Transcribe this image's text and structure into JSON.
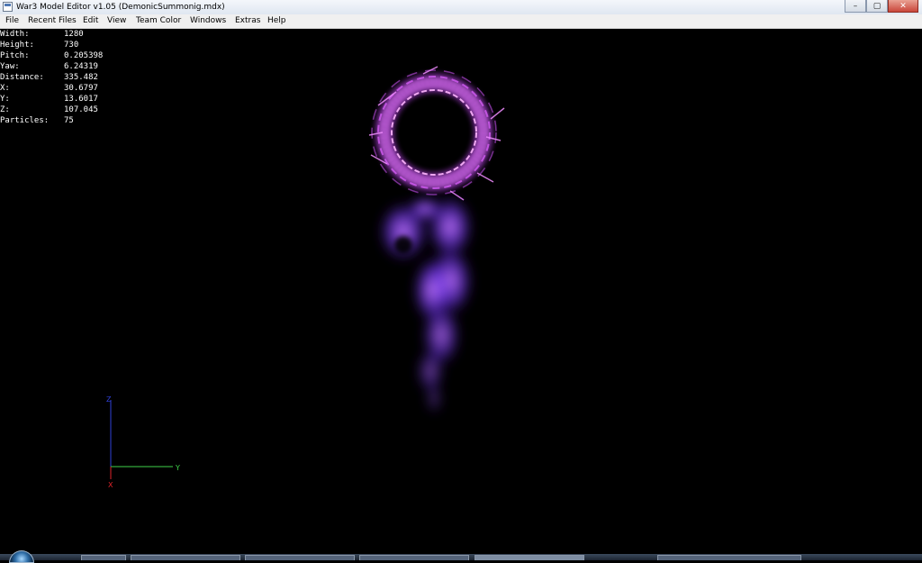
{
  "window": {
    "title": "War3 Model Editor v1.05 (DemonicSummonig.mdx)",
    "buttons": {
      "minimize": "–",
      "maximize": "▢",
      "close": "✕"
    }
  },
  "menu": [
    "File",
    "Recent Files",
    "Edit",
    "View",
    "Team Color",
    "Windows",
    "Extras",
    "Help"
  ],
  "stats": [
    {
      "key": "Width:",
      "value": "1280"
    },
    {
      "key": "Height:",
      "value": "730"
    },
    {
      "key": "Pitch:",
      "value": "0.205398"
    },
    {
      "key": "Yaw:",
      "value": "6.24319"
    },
    {
      "key": "Distance:",
      "value": "335.482"
    },
    {
      "key": "X:",
      "value": "30.6797"
    },
    {
      "key": "Y:",
      "value": "13.6017"
    },
    {
      "key": "Z:",
      "value": "107.045"
    },
    {
      "key": "Particles:",
      "value": "75"
    }
  ],
  "axes": {
    "z_label": "Z",
    "y_label": "Y",
    "x_label": "X"
  },
  "colors": {
    "axis_z": "#2f3fd6",
    "axis_y": "#3fd24a",
    "axis_x": "#e0242a",
    "ring": "#e06aff",
    "smoke": "#8a4bff"
  }
}
